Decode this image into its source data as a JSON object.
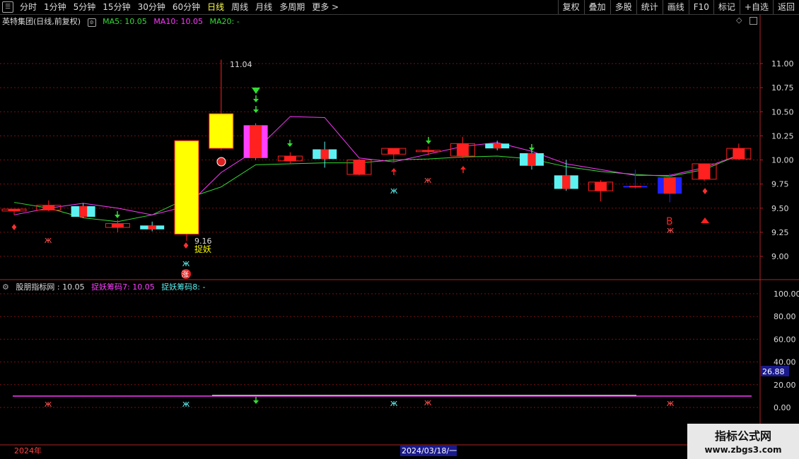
{
  "toolbar": {
    "left_items": [
      "分时",
      "1分钟",
      "5分钟",
      "15分钟",
      "30分钟",
      "60分钟",
      "日线",
      "周线",
      "月线",
      "多周期",
      "更多 >"
    ],
    "active": "日线",
    "right_items": [
      "复权",
      "叠加",
      "多股",
      "统计",
      "画线",
      "F10",
      "标记",
      "+自选",
      "返回"
    ]
  },
  "main_legend": {
    "title": "英特集团(日线,前复权)",
    "ma5": "MA5: 10.05",
    "ma10": "MA10: 10.05",
    "ma20": "MA20: -"
  },
  "sub_legend": {
    "title": "股朋指标网 : 10.05",
    "s7": "捉妖筹码7: 10.05",
    "s8": "捉妖筹码8: -"
  },
  "annotations": {
    "high_label": "11.04",
    "low_label": "9.16",
    "zhuoyao": "捉妖",
    "zhang": "涨",
    "b_mark": "B",
    "sub_value_box": "26.88",
    "year_label": "2024年",
    "date_label": "2024/03/18/一"
  },
  "watermark": {
    "line1": "指标公式网",
    "line2": "www.zbgs3.com"
  },
  "colors": {
    "up": "#ff2020",
    "down": "#5cf2f2",
    "ma5": "#ffffff",
    "ma10": "#ff38ff",
    "ma20": "#33dd33",
    "grid": "#7a1010",
    "axis": "#b22222",
    "yellow": "#ffff00",
    "magenta": "#ff40ff",
    "blue": "#2222ff"
  },
  "chart_data": {
    "type": "candlestick",
    "price_axis": {
      "ticks": [
        "11.00",
        "10.75",
        "10.50",
        "10.25",
        "10.00",
        "9.75",
        "9.50",
        "9.25",
        "9.00"
      ]
    },
    "indicator_axis": {
      "ticks": [
        "100.00",
        "80.00",
        "60.00",
        "40.00",
        "20.00",
        "0.00"
      ]
    },
    "candles": [
      {
        "o": 9.49,
        "c": 9.47,
        "h": 9.49,
        "l": 9.43,
        "color": "red"
      },
      {
        "o": 9.48,
        "c": 9.53,
        "h": 9.58,
        "l": 9.47,
        "color": "red"
      },
      {
        "o": 9.52,
        "c": 9.41,
        "h": 9.55,
        "l": 9.4,
        "color": "cyan"
      },
      {
        "o": 9.3,
        "c": 9.34,
        "h": 9.38,
        "l": 9.25,
        "color": "red"
      },
      {
        "o": 9.32,
        "c": 9.28,
        "h": 9.36,
        "l": 9.26,
        "color": "cyan"
      },
      {
        "o": 9.23,
        "c": 10.2,
        "h": 10.2,
        "l": 9.16,
        "color": "yellow"
      },
      {
        "o": 10.12,
        "c": 10.48,
        "h": 11.04,
        "l": 10.1,
        "color": "yellow"
      },
      {
        "o": 10.36,
        "c": 10.02,
        "h": 10.38,
        "l": 10.0,
        "color": "magenta"
      },
      {
        "o": 9.99,
        "c": 10.04,
        "h": 10.08,
        "l": 9.96,
        "color": "red"
      },
      {
        "o": 10.11,
        "c": 10.01,
        "h": 10.19,
        "l": 9.92,
        "color": "cyan"
      },
      {
        "o": 9.85,
        "c": 10.0,
        "h": 10.01,
        "l": 9.84,
        "color": "red"
      },
      {
        "o": 10.06,
        "c": 10.12,
        "h": 10.12,
        "l": 9.98,
        "color": "red"
      },
      {
        "o": 10.1,
        "c": 10.09,
        "h": 10.14,
        "l": 10.05,
        "color": "red"
      },
      {
        "o": 10.04,
        "c": 10.17,
        "h": 10.24,
        "l": 10.02,
        "color": "red"
      },
      {
        "o": 10.17,
        "c": 10.12,
        "h": 10.2,
        "l": 10.1,
        "color": "cyan"
      },
      {
        "o": 10.07,
        "c": 9.94,
        "h": 10.13,
        "l": 9.9,
        "color": "cyan"
      },
      {
        "o": 9.7,
        "c": 9.84,
        "h": 10.0,
        "l": 9.68,
        "color": "cyan"
      },
      {
        "o": 9.68,
        "c": 9.77,
        "h": 9.79,
        "l": 9.57,
        "color": "red"
      },
      {
        "o": 9.73,
        "c": 9.72,
        "h": 9.9,
        "l": 9.7,
        "color": "blue"
      },
      {
        "o": 9.65,
        "c": 9.82,
        "h": 9.86,
        "l": 9.56,
        "color": "blue"
      },
      {
        "o": 9.8,
        "c": 9.96,
        "h": 9.96,
        "l": 9.78,
        "color": "red"
      },
      {
        "o": 10.01,
        "c": 10.12,
        "h": 10.17,
        "l": 10.0,
        "color": "red"
      }
    ],
    "ma5": [
      9.43,
      9.5,
      9.55,
      9.5,
      9.43,
      9.52,
      9.87,
      10.1,
      10.45,
      10.44,
      10.02,
      9.98,
      10.06,
      10.14,
      10.18,
      10.09,
      9.96,
      9.9,
      9.84,
      9.84,
      9.92,
      10.05
    ],
    "ma20": [
      9.56,
      9.5,
      9.4,
      9.36,
      9.43,
      9.6,
      9.72,
      9.95,
      9.96,
      9.97,
      9.97,
      10.0,
      10.01,
      10.03,
      10.04,
      10.01,
      9.93,
      9.88,
      9.85,
      9.83,
      9.9,
      10.05
    ],
    "indicator_level": 10.05
  }
}
